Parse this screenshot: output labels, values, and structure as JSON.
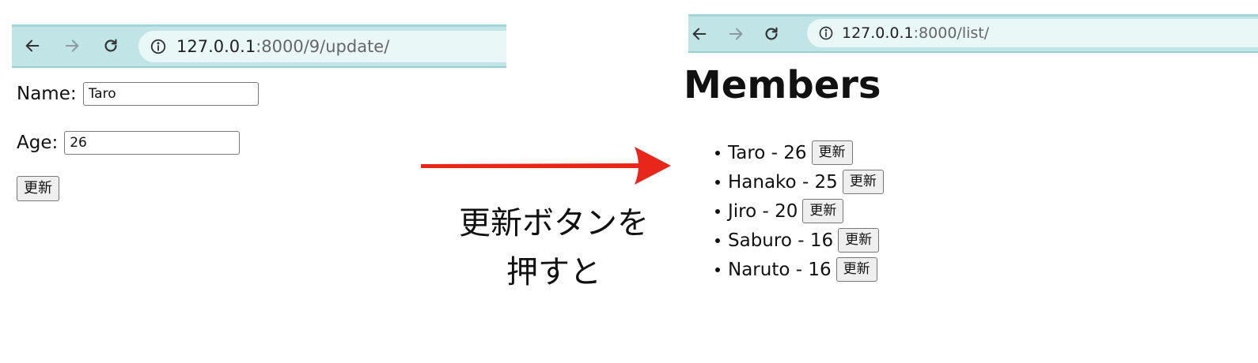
{
  "left_window": {
    "url_host": "127.0.0.1",
    "url_path": ":8000/9/update/",
    "icons": [
      "back-arrow-icon",
      "forward-arrow-icon",
      "reload-icon",
      "info-icon"
    ],
    "form": {
      "name_label": "Name:",
      "name_value": "Taro",
      "age_label": "Age:",
      "age_value": "26",
      "submit_label": "更新"
    }
  },
  "annotation": {
    "arrow_color": "#e8261a",
    "caption_line1": "更新ボタンを",
    "caption_line2": "押すと"
  },
  "right_window": {
    "url_host": "127.0.0.1",
    "url_path": ":8000/list/",
    "icons": [
      "back-arrow-icon",
      "forward-arrow-icon",
      "reload-icon",
      "info-icon"
    ],
    "page_title": "Members",
    "members": [
      {
        "text": "Taro - 26",
        "button": "更新"
      },
      {
        "text": "Hanako - 25",
        "button": "更新"
      },
      {
        "text": "Jiro - 20",
        "button": "更新"
      },
      {
        "text": "Saburo - 16",
        "button": "更新"
      },
      {
        "text": "Naruto - 16",
        "button": "更新"
      }
    ]
  },
  "colors": {
    "toolbar": "#c1e4e6",
    "omnibox": "#eaf7f7"
  }
}
